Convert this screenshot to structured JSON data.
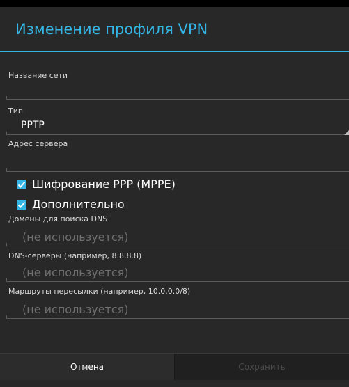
{
  "dialog": {
    "title": "Изменение профиля VPN"
  },
  "form": {
    "name_label": "Название сети",
    "type_label": "Тип",
    "type_value": "PPTP",
    "server_label": "Адрес сервера",
    "mppe_label": "Шифрование PPP (MPPE)",
    "mppe_checked": true,
    "advanced_label": "Дополнительно",
    "advanced_checked": true,
    "dns_search_label": "Домены для поиска DNS",
    "dns_search_placeholder": "(не используется)",
    "dns_servers_label": "DNS-серверы (например, 8.8.8.8)",
    "dns_servers_placeholder": "(не используется)",
    "routes_label": "Маршруты пересылки (например, 10.0.0.0/8)",
    "routes_placeholder": "(не используется)"
  },
  "buttons": {
    "cancel": "Отмена",
    "save": "Сохранить"
  },
  "colors": {
    "accent": "#33b5e5",
    "background": "#282828"
  }
}
